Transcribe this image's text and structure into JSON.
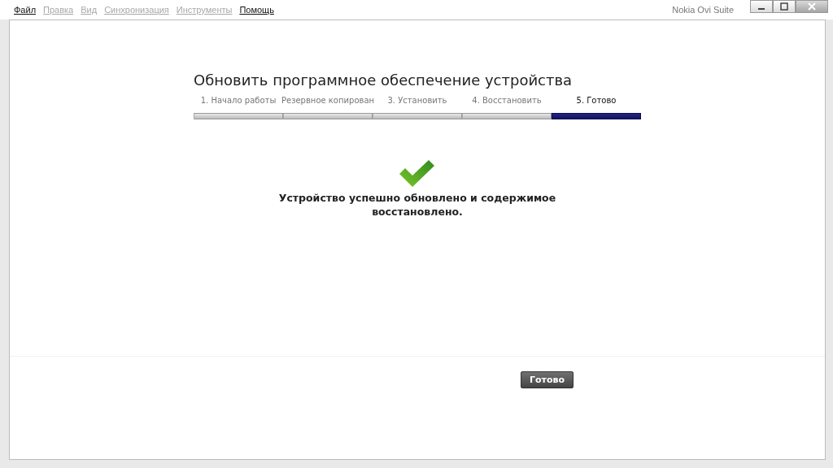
{
  "menu": [
    {
      "label": "Файл",
      "disabled": false
    },
    {
      "label": "Правка",
      "disabled": true
    },
    {
      "label": "Вид",
      "disabled": true
    },
    {
      "label": "Синхронизация",
      "disabled": true
    },
    {
      "label": "Инструменты",
      "disabled": true
    },
    {
      "label": "Помощь",
      "disabled": false
    }
  ],
  "window": {
    "title": "Nokia Ovi Suite"
  },
  "dialog": {
    "title": "Обновить программное обеспечение устройства",
    "steps": [
      {
        "label": "1. Начало работы",
        "selected": false
      },
      {
        "label": "Резервное копирован",
        "selected": false
      },
      {
        "label": "3. Установить",
        "selected": false
      },
      {
        "label": "4. Восстановить",
        "selected": false
      },
      {
        "label": "5. Готово",
        "selected": true
      }
    ],
    "message": "Устройство успешно обновлено и содержимое восстановлено.",
    "button": "Готово"
  }
}
